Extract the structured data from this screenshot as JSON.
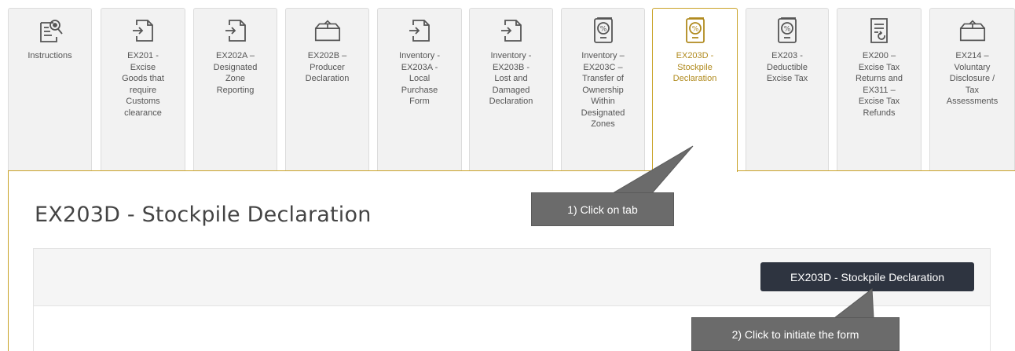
{
  "tabs": [
    {
      "label": "Instructions",
      "icon": "document-search-icon"
    },
    {
      "label": "EX201 -\nExcise\nGoods that\nrequire\nCustoms\nclearance",
      "icon": "form-entry-icon"
    },
    {
      "label": "EX202A –\nDesignated\nZone\nReporting",
      "icon": "form-entry-icon"
    },
    {
      "label": "EX202B –\nProducer\nDeclaration",
      "icon": "open-box-icon"
    },
    {
      "label": "Inventory -\nEX203A -\nLocal\nPurchase\nForm",
      "icon": "form-entry-icon"
    },
    {
      "label": "Inventory -\nEX203B -\nLost and\nDamaged\nDeclaration",
      "icon": "form-entry-icon"
    },
    {
      "label": "Inventory –\nEX203C –\nTransfer of\nOwnership\nWithin\nDesignated\nZones",
      "icon": "percent-document-icon"
    },
    {
      "label": "EX203D -\nStockpile\nDeclaration",
      "icon": "percent-document-icon",
      "active": true
    },
    {
      "label": "EX203 -\nDeductible\nExcise Tax",
      "icon": "percent-document-icon"
    },
    {
      "label": "EX200 –\nExcise Tax\nReturns and\nEX311 –\nExcise Tax\nRefunds",
      "icon": "refund-document-icon"
    },
    {
      "label": "EX214 –\nVoluntary\nDisclosure /\nTax\nAssessments",
      "icon": "open-box-icon"
    }
  ],
  "page_title": "EX203D - Stockpile Declaration",
  "action_button": "EX203D - Stockpile Declaration",
  "callouts": {
    "step1": "1) Click on tab",
    "step2": "2) Click to initiate the form"
  },
  "colors": {
    "accent_gold": "#c9a227",
    "button_dark": "#2e3440",
    "callout_gray": "#6b6b6b"
  }
}
